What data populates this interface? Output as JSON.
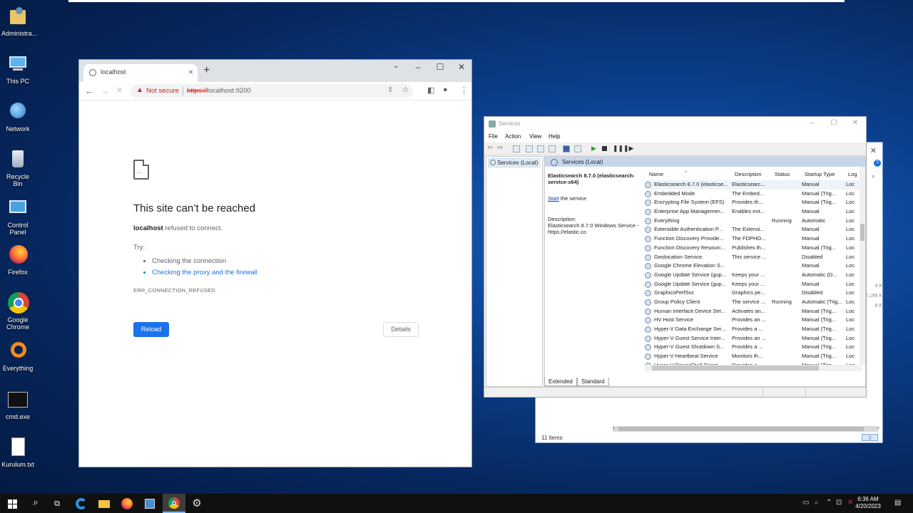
{
  "desktop": {
    "icons": [
      {
        "label": "Administra...",
        "icon": "user-folder-icon"
      },
      {
        "label": "This PC",
        "icon": "computer-icon"
      },
      {
        "label": "Network",
        "icon": "network-icon"
      },
      {
        "label": "Recycle Bin",
        "icon": "recycle-bin-icon"
      },
      {
        "label": "Control Panel",
        "icon": "control-panel-icon"
      },
      {
        "label": "Firefox",
        "icon": "firefox-icon"
      },
      {
        "label": "Google Chrome",
        "icon": "chrome-icon"
      },
      {
        "label": "Everything",
        "icon": "everything-icon"
      },
      {
        "label": "cmd.exe",
        "icon": "cmd-icon"
      },
      {
        "label": "Kurulum.txt",
        "icon": "text-file-icon"
      }
    ]
  },
  "chrome": {
    "tab_title": "localhost",
    "security_label": "Not secure",
    "url_protocol": "https://",
    "url_host": "localhost:9200",
    "error": {
      "title": "This site can’t be reached",
      "host": "localhost",
      "message": "refused to connect.",
      "try_label": "Try:",
      "suggestions": [
        "Checking the connection",
        "Checking the proxy and the firewall"
      ],
      "code": "ERR_CONNECTION_REFUSED"
    },
    "reload_label": "Reload",
    "details_label": "Details",
    "accent": "#1a73e8"
  },
  "services": {
    "window_title": "Services",
    "menu": [
      "File",
      "Action",
      "View",
      "Help"
    ],
    "tree_node": "Services (Local)",
    "pane_header": "Services (Local)",
    "detail": {
      "name": "Elasticsearch 8.7.0 (elasticsearch-service-x64)",
      "start_link": "Start",
      "start_suffix": " the service",
      "description_label": "Description:",
      "description": "Elasticsearch 8.7.0 Windows Service - https://elastic.co"
    },
    "columns": [
      "Name",
      "Description",
      "Status",
      "Startup Type",
      "Log"
    ],
    "rows": [
      {
        "name": "Elasticsearch 8.7.0 (elasticse...",
        "desc": "Elasticsearc...",
        "status": "",
        "startup": "Manual",
        "log": "Loc"
      },
      {
        "name": "Embedded Mode",
        "desc": "The Embed...",
        "status": "",
        "startup": "Manual (Trig...",
        "log": "Loc"
      },
      {
        "name": "Encrypting File System (EFS)",
        "desc": "Provides th...",
        "status": "",
        "startup": "Manual (Trig...",
        "log": "Loc"
      },
      {
        "name": "Enterprise App Managemen...",
        "desc": "Enables ent...",
        "status": "",
        "startup": "Manual",
        "log": "Loc"
      },
      {
        "name": "Everything",
        "desc": "",
        "status": "Running",
        "startup": "Automatic",
        "log": "Loc"
      },
      {
        "name": "Extensible Authentication P...",
        "desc": "The Extensi...",
        "status": "",
        "startup": "Manual",
        "log": "Loc"
      },
      {
        "name": "Function Discovery Provide...",
        "desc": "The FDPHO...",
        "status": "",
        "startup": "Manual",
        "log": "Loc"
      },
      {
        "name": "Function Discovery Resourc...",
        "desc": "Publishes th...",
        "status": "",
        "startup": "Manual (Trig...",
        "log": "Loc"
      },
      {
        "name": "Geolocation Service",
        "desc": "This service ...",
        "status": "",
        "startup": "Disabled",
        "log": "Loc"
      },
      {
        "name": "Google Chrome Elevation S...",
        "desc": "",
        "status": "",
        "startup": "Manual",
        "log": "Loc"
      },
      {
        "name": "Google Update Service (gup...",
        "desc": "Keeps your ...",
        "status": "",
        "startup": "Automatic (D...",
        "log": "Loc"
      },
      {
        "name": "Google Update Service (gup...",
        "desc": "Keeps your ...",
        "status": "",
        "startup": "Manual",
        "log": "Loc"
      },
      {
        "name": "GraphicsPerfSvc",
        "desc": "Graphics pe...",
        "status": "",
        "startup": "Disabled",
        "log": "Loc"
      },
      {
        "name": "Group Policy Client",
        "desc": "The service ...",
        "status": "Running",
        "startup": "Automatic (Trig...",
        "log": "Loc"
      },
      {
        "name": "Human Interface Device Ser...",
        "desc": "Activates an...",
        "status": "",
        "startup": "Manual (Trig...",
        "log": "Loc"
      },
      {
        "name": "HV Host Service",
        "desc": "Provides an ...",
        "status": "",
        "startup": "Manual (Trig...",
        "log": "Loc"
      },
      {
        "name": "Hyper-V Data Exchange Ser...",
        "desc": "Provides a ...",
        "status": "",
        "startup": "Manual (Trig...",
        "log": "Loc"
      },
      {
        "name": "Hyper-V Guest Service Inter...",
        "desc": "Provides an ...",
        "status": "",
        "startup": "Manual (Trig...",
        "log": "Loc"
      },
      {
        "name": "Hyper-V Guest Shutdown S...",
        "desc": "Provides a ...",
        "status": "",
        "startup": "Manual (Trig...",
        "log": "Loc"
      },
      {
        "name": "Hyper-V Heartbeat Service",
        "desc": "Monitors th...",
        "status": "",
        "startup": "Manual (Trig...",
        "log": "Loc"
      },
      {
        "name": "Hyper-V PowerShell Direct ...",
        "desc": "Provides a ...",
        "status": "",
        "startup": "Manual (Trig...",
        "log": "Loc"
      }
    ],
    "tabs": [
      "Extended",
      "Standard"
    ]
  },
  "explorer": {
    "status": "11 items",
    "side_values": [
      "4 K",
      "2,199 K",
      "8 K"
    ]
  },
  "taskbar": {
    "time": "6:36 AM",
    "date": "4/20/2023",
    "apps": [
      "start-icon",
      "search-icon",
      "task-view-icon",
      "edge-icon",
      "file-explorer-icon",
      "firefox-icon",
      "server-manager-icon",
      "chrome-icon",
      "services-icon"
    ]
  }
}
